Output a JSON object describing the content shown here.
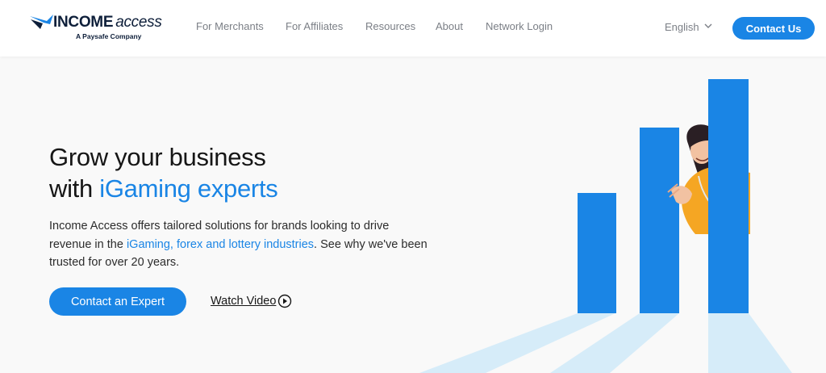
{
  "header": {
    "logo": {
      "word_bold": "INCOME",
      "word_light": "access",
      "tagline": "A Paysafe Company"
    },
    "nav": [
      {
        "label": "For Merchants"
      },
      {
        "label": "For Affiliates"
      },
      {
        "label": "Resources"
      },
      {
        "label": "About"
      },
      {
        "label": "Network Login"
      }
    ],
    "language": {
      "selected": "English",
      "icon": "chevron-down-icon"
    },
    "contact_label": "Contact Us"
  },
  "hero": {
    "headline_line1": "Grow your business",
    "headline_line2_prefix": "with ",
    "headline_line2_accent": "iGaming experts",
    "description_before": "Income Access offers tailored solutions for brands looking to drive revenue in the ",
    "description_link": "iGaming, forex and lottery industries",
    "description_after": ". See why we've been trusted for over 20 years.",
    "primary_cta": "Contact an Expert",
    "secondary_cta": "Watch Video",
    "secondary_icon": "play-circle-icon"
  },
  "colors": {
    "accent": "#1a85e5",
    "navy": "#0e1f3a",
    "nav_text": "#7b7f86",
    "bar_blue": "#1a85e5",
    "shadow_blue": "#d6ecf9"
  }
}
